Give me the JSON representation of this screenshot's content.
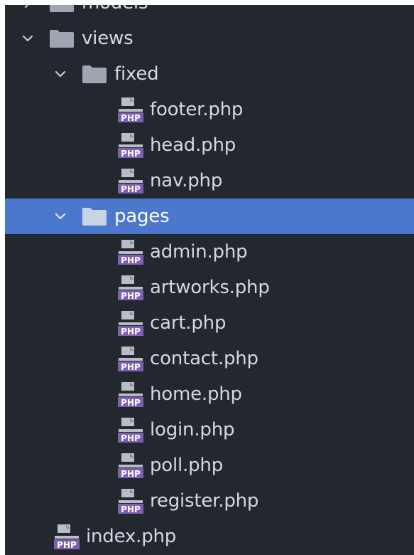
{
  "colors": {
    "panel_bg": "#23272e",
    "selected_bg": "#4b77cc",
    "text": "#d5d8de",
    "folder": "#9fa6b2",
    "php_badge": "#7e5fb5"
  },
  "tree": [
    {
      "name": "models",
      "kind": "folder",
      "expanded": false,
      "depth": 0
    },
    {
      "name": "views",
      "kind": "folder",
      "expanded": true,
      "depth": 0
    },
    {
      "name": "fixed",
      "kind": "folder",
      "expanded": true,
      "depth": 1
    },
    {
      "name": "footer.php",
      "kind": "php-file",
      "depth": 2
    },
    {
      "name": "head.php",
      "kind": "php-file",
      "depth": 2
    },
    {
      "name": "nav.php",
      "kind": "php-file",
      "depth": 2
    },
    {
      "name": "pages",
      "kind": "folder",
      "expanded": true,
      "depth": 1,
      "selected": true
    },
    {
      "name": "admin.php",
      "kind": "php-file",
      "depth": 2
    },
    {
      "name": "artworks.php",
      "kind": "php-file",
      "depth": 2
    },
    {
      "name": "cart.php",
      "kind": "php-file",
      "depth": 2
    },
    {
      "name": "contact.php",
      "kind": "php-file",
      "depth": 2
    },
    {
      "name": "home.php",
      "kind": "php-file",
      "depth": 2
    },
    {
      "name": "login.php",
      "kind": "php-file",
      "depth": 2
    },
    {
      "name": "poll.php",
      "kind": "php-file",
      "depth": 2
    },
    {
      "name": "register.php",
      "kind": "php-file",
      "depth": 2
    },
    {
      "name": "index.php",
      "kind": "php-file",
      "depth": 1
    }
  ],
  "icon_names": {
    "folder": "folder-icon",
    "php-file": "php-file-icon",
    "chevron_down": "chevron-down-icon",
    "chevron_right": "chevron-right-icon"
  }
}
